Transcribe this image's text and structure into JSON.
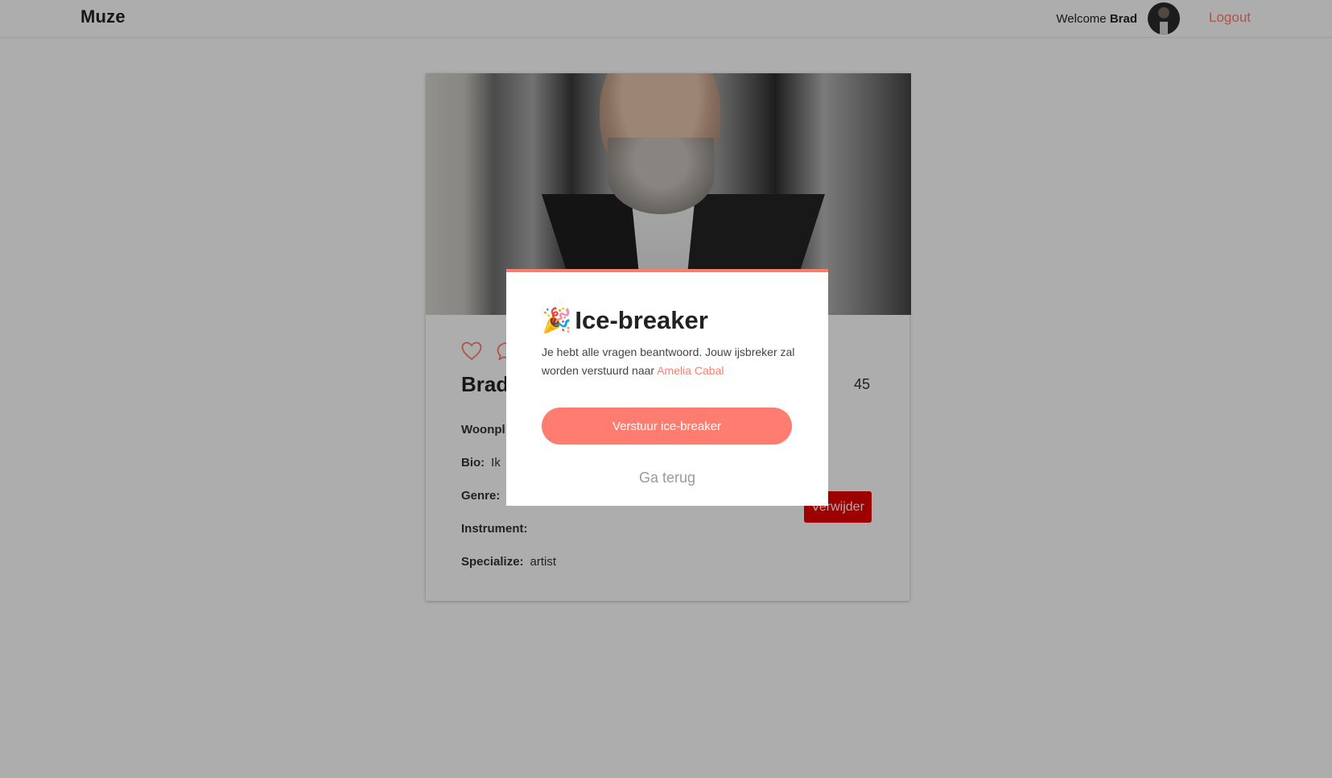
{
  "header": {
    "brand": "Muze",
    "welcome_prefix": "Welcome",
    "welcome_name": "Brad",
    "logout_label": "Logout"
  },
  "profile": {
    "name": "Brad",
    "age": "45",
    "fields": [
      {
        "label": "Woonpl",
        "value": ""
      },
      {
        "label": "Bio:",
        "value": "Ik"
      },
      {
        "label": "Genre:",
        "value": ""
      },
      {
        "label": "Instrument:",
        "value": ""
      },
      {
        "label": "Specialize:",
        "value": "artist"
      }
    ],
    "delete_label": "Verwijder"
  },
  "modal": {
    "emoji": "🎉",
    "title": "Ice-breaker",
    "text_prefix": "Je hebt alle vragen beantwoord. Jouw ijsbreker zal worden verstuurd naar",
    "recipient": "Amelia Cabal",
    "send_label": "Verstuur ice-breaker",
    "back_label": "Ga terug"
  },
  "colors": {
    "accent": "#ff7d70",
    "danger": "#e60000"
  }
}
